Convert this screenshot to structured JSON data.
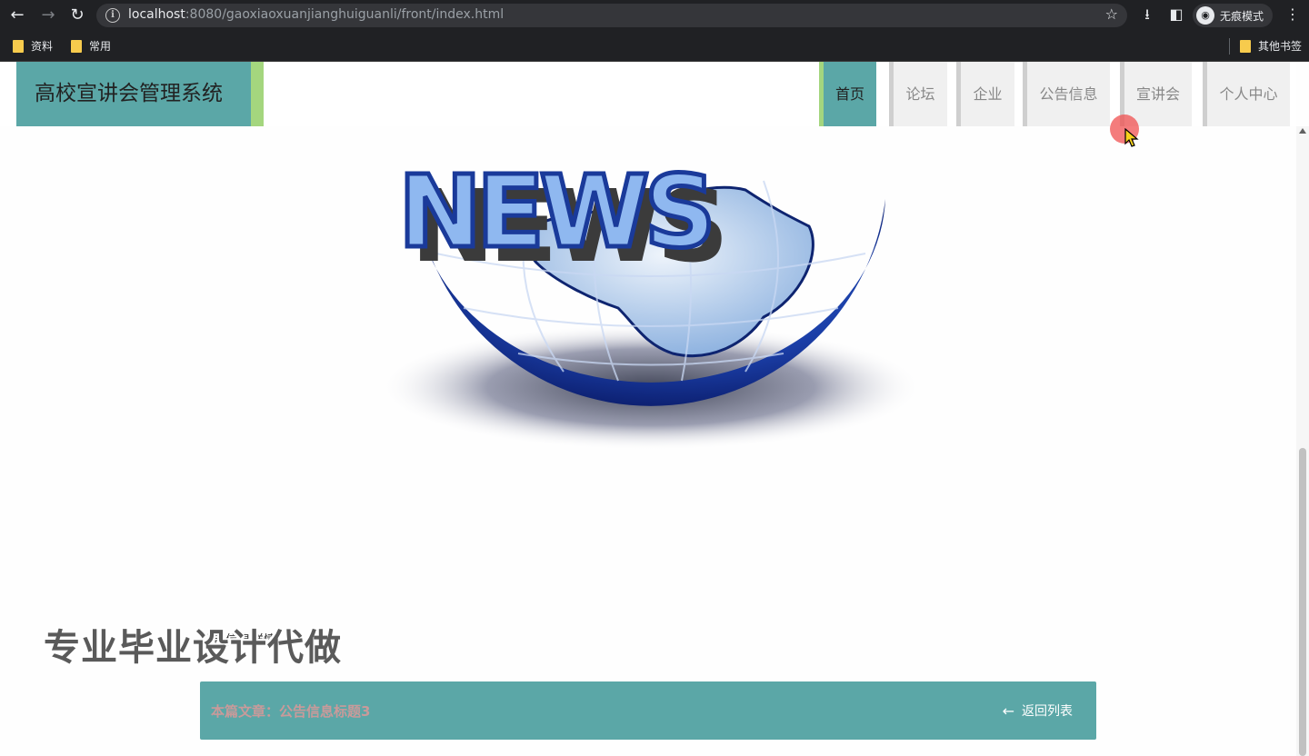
{
  "browser": {
    "url_host": "localhost",
    "url_rest": ":8080/gaoxiaoxuanjianghuiguanli/front/index.html",
    "incognito_label": "无痕模式",
    "bookmarks": [
      "资料",
      "常用"
    ],
    "other_bookmarks": "其他书签"
  },
  "site": {
    "title": "高校宣讲会管理系统",
    "menu": [
      "首页",
      "论坛",
      "企业",
      "公告信息",
      "宣讲会",
      "个人中心"
    ],
    "active_menu": "首页"
  },
  "banner": {
    "headline": "NEWS"
  },
  "watermark": "专业毕业设计代做",
  "detail_label": "公告信息详情",
  "article": {
    "prefix": "本篇文章：",
    "title": "公告信息标题3",
    "back_label": "返回列表"
  },
  "colors": {
    "accent": "#5ba7a7",
    "accent_secondary": "#a4d67e"
  }
}
